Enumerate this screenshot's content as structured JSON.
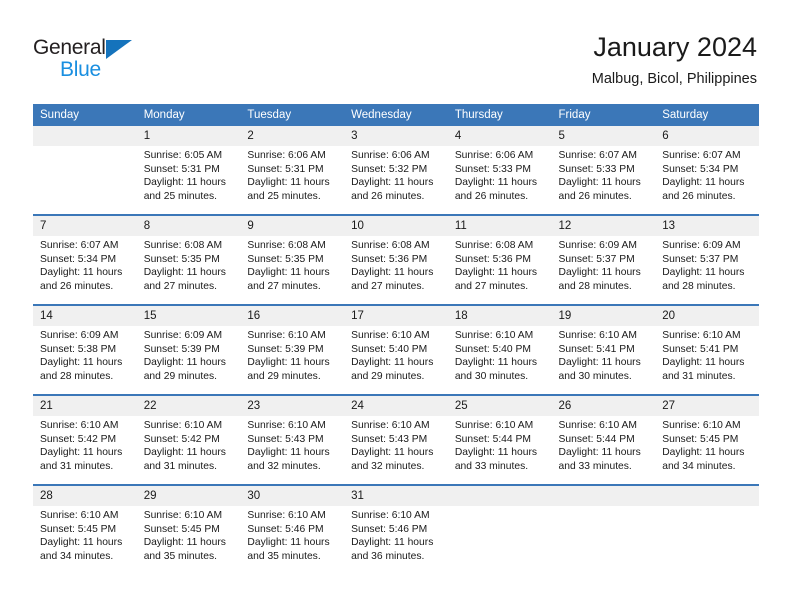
{
  "brand": {
    "word_general": "General",
    "word_blue": "Blue",
    "triangle_color": "#1573bc",
    "blue_color": "#1a8fe0"
  },
  "header": {
    "title": "January 2024",
    "subtitle": "Malbug, Bicol, Philippines"
  },
  "calendar": {
    "accent_color": "#3b77b8",
    "daynum_band_color": "#f0f0f0",
    "weekday_headers": [
      "Sunday",
      "Monday",
      "Tuesday",
      "Wednesday",
      "Thursday",
      "Friday",
      "Saturday"
    ],
    "weeks": [
      [
        {
          "day": "",
          "sunrise": "",
          "sunset": "",
          "daylight": "",
          "daylight2": ""
        },
        {
          "day": "1",
          "sunrise": "Sunrise: 6:05 AM",
          "sunset": "Sunset: 5:31 PM",
          "daylight": "Daylight: 11 hours",
          "daylight2": "and 25 minutes."
        },
        {
          "day": "2",
          "sunrise": "Sunrise: 6:06 AM",
          "sunset": "Sunset: 5:31 PM",
          "daylight": "Daylight: 11 hours",
          "daylight2": "and 25 minutes."
        },
        {
          "day": "3",
          "sunrise": "Sunrise: 6:06 AM",
          "sunset": "Sunset: 5:32 PM",
          "daylight": "Daylight: 11 hours",
          "daylight2": "and 26 minutes."
        },
        {
          "day": "4",
          "sunrise": "Sunrise: 6:06 AM",
          "sunset": "Sunset: 5:33 PM",
          "daylight": "Daylight: 11 hours",
          "daylight2": "and 26 minutes."
        },
        {
          "day": "5",
          "sunrise": "Sunrise: 6:07 AM",
          "sunset": "Sunset: 5:33 PM",
          "daylight": "Daylight: 11 hours",
          "daylight2": "and 26 minutes."
        },
        {
          "day": "6",
          "sunrise": "Sunrise: 6:07 AM",
          "sunset": "Sunset: 5:34 PM",
          "daylight": "Daylight: 11 hours",
          "daylight2": "and 26 minutes."
        }
      ],
      [
        {
          "day": "7",
          "sunrise": "Sunrise: 6:07 AM",
          "sunset": "Sunset: 5:34 PM",
          "daylight": "Daylight: 11 hours",
          "daylight2": "and 26 minutes."
        },
        {
          "day": "8",
          "sunrise": "Sunrise: 6:08 AM",
          "sunset": "Sunset: 5:35 PM",
          "daylight": "Daylight: 11 hours",
          "daylight2": "and 27 minutes."
        },
        {
          "day": "9",
          "sunrise": "Sunrise: 6:08 AM",
          "sunset": "Sunset: 5:35 PM",
          "daylight": "Daylight: 11 hours",
          "daylight2": "and 27 minutes."
        },
        {
          "day": "10",
          "sunrise": "Sunrise: 6:08 AM",
          "sunset": "Sunset: 5:36 PM",
          "daylight": "Daylight: 11 hours",
          "daylight2": "and 27 minutes."
        },
        {
          "day": "11",
          "sunrise": "Sunrise: 6:08 AM",
          "sunset": "Sunset: 5:36 PM",
          "daylight": "Daylight: 11 hours",
          "daylight2": "and 27 minutes."
        },
        {
          "day": "12",
          "sunrise": "Sunrise: 6:09 AM",
          "sunset": "Sunset: 5:37 PM",
          "daylight": "Daylight: 11 hours",
          "daylight2": "and 28 minutes."
        },
        {
          "day": "13",
          "sunrise": "Sunrise: 6:09 AM",
          "sunset": "Sunset: 5:37 PM",
          "daylight": "Daylight: 11 hours",
          "daylight2": "and 28 minutes."
        }
      ],
      [
        {
          "day": "14",
          "sunrise": "Sunrise: 6:09 AM",
          "sunset": "Sunset: 5:38 PM",
          "daylight": "Daylight: 11 hours",
          "daylight2": "and 28 minutes."
        },
        {
          "day": "15",
          "sunrise": "Sunrise: 6:09 AM",
          "sunset": "Sunset: 5:39 PM",
          "daylight": "Daylight: 11 hours",
          "daylight2": "and 29 minutes."
        },
        {
          "day": "16",
          "sunrise": "Sunrise: 6:10 AM",
          "sunset": "Sunset: 5:39 PM",
          "daylight": "Daylight: 11 hours",
          "daylight2": "and 29 minutes."
        },
        {
          "day": "17",
          "sunrise": "Sunrise: 6:10 AM",
          "sunset": "Sunset: 5:40 PM",
          "daylight": "Daylight: 11 hours",
          "daylight2": "and 29 minutes."
        },
        {
          "day": "18",
          "sunrise": "Sunrise: 6:10 AM",
          "sunset": "Sunset: 5:40 PM",
          "daylight": "Daylight: 11 hours",
          "daylight2": "and 30 minutes."
        },
        {
          "day": "19",
          "sunrise": "Sunrise: 6:10 AM",
          "sunset": "Sunset: 5:41 PM",
          "daylight": "Daylight: 11 hours",
          "daylight2": "and 30 minutes."
        },
        {
          "day": "20",
          "sunrise": "Sunrise: 6:10 AM",
          "sunset": "Sunset: 5:41 PM",
          "daylight": "Daylight: 11 hours",
          "daylight2": "and 31 minutes."
        }
      ],
      [
        {
          "day": "21",
          "sunrise": "Sunrise: 6:10 AM",
          "sunset": "Sunset: 5:42 PM",
          "daylight": "Daylight: 11 hours",
          "daylight2": "and 31 minutes."
        },
        {
          "day": "22",
          "sunrise": "Sunrise: 6:10 AM",
          "sunset": "Sunset: 5:42 PM",
          "daylight": "Daylight: 11 hours",
          "daylight2": "and 31 minutes."
        },
        {
          "day": "23",
          "sunrise": "Sunrise: 6:10 AM",
          "sunset": "Sunset: 5:43 PM",
          "daylight": "Daylight: 11 hours",
          "daylight2": "and 32 minutes."
        },
        {
          "day": "24",
          "sunrise": "Sunrise: 6:10 AM",
          "sunset": "Sunset: 5:43 PM",
          "daylight": "Daylight: 11 hours",
          "daylight2": "and 32 minutes."
        },
        {
          "day": "25",
          "sunrise": "Sunrise: 6:10 AM",
          "sunset": "Sunset: 5:44 PM",
          "daylight": "Daylight: 11 hours",
          "daylight2": "and 33 minutes."
        },
        {
          "day": "26",
          "sunrise": "Sunrise: 6:10 AM",
          "sunset": "Sunset: 5:44 PM",
          "daylight": "Daylight: 11 hours",
          "daylight2": "and 33 minutes."
        },
        {
          "day": "27",
          "sunrise": "Sunrise: 6:10 AM",
          "sunset": "Sunset: 5:45 PM",
          "daylight": "Daylight: 11 hours",
          "daylight2": "and 34 minutes."
        }
      ],
      [
        {
          "day": "28",
          "sunrise": "Sunrise: 6:10 AM",
          "sunset": "Sunset: 5:45 PM",
          "daylight": "Daylight: 11 hours",
          "daylight2": "and 34 minutes."
        },
        {
          "day": "29",
          "sunrise": "Sunrise: 6:10 AM",
          "sunset": "Sunset: 5:45 PM",
          "daylight": "Daylight: 11 hours",
          "daylight2": "and 35 minutes."
        },
        {
          "day": "30",
          "sunrise": "Sunrise: 6:10 AM",
          "sunset": "Sunset: 5:46 PM",
          "daylight": "Daylight: 11 hours",
          "daylight2": "and 35 minutes."
        },
        {
          "day": "31",
          "sunrise": "Sunrise: 6:10 AM",
          "sunset": "Sunset: 5:46 PM",
          "daylight": "Daylight: 11 hours",
          "daylight2": "and 36 minutes."
        },
        {
          "day": "",
          "sunrise": "",
          "sunset": "",
          "daylight": "",
          "daylight2": ""
        },
        {
          "day": "",
          "sunrise": "",
          "sunset": "",
          "daylight": "",
          "daylight2": ""
        },
        {
          "day": "",
          "sunrise": "",
          "sunset": "",
          "daylight": "",
          "daylight2": ""
        }
      ]
    ]
  }
}
